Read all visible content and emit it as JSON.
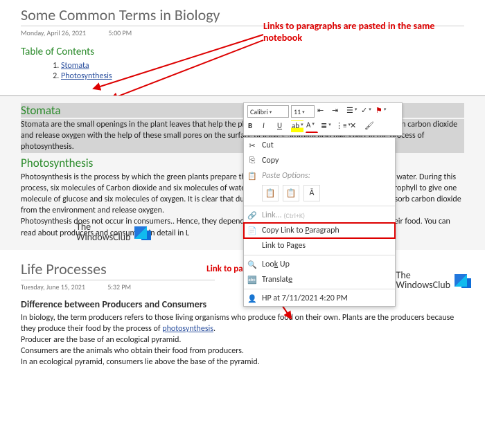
{
  "top": {
    "title": "Some Common Terms in Biology",
    "date": "Monday, April 26, 2021",
    "time": "5:00 PM",
    "tocHeading": "Table of Contents",
    "tocItems": [
      "Stomata",
      "Photosynthesis"
    ],
    "sec1Title": "Stomata",
    "sec1Body": "Stomata are the small openings in the plant leaves that help the plants in the exchange of gases. The plants take in carbon dioxide and release oxygen with the help of these small pores on the surface of leaves. Stomata also takes part in the process of photosynthesis.",
    "sec2Title": "Photosynthesis",
    "sec2Body1": "Photosynthesis is the process by which the green plants prepare their own food in the presence of sunlight and water. During this process, six molecules of Carbon dioxide and six molecules of water combine in the presence of water and chlorophyll to give one molecule of glucose and six molecules of oxygen. It is clear that during the process of photosynthesis, plants absorb carbon dioxide from the environment and release oxygen.",
    "sec2Body2a": "Photosynthesis does not occur in consumers.. Hence, they depend on other organisms (producers) to obtain their food. You can read about producers and consumers in detail in L"
  },
  "annot": {
    "a1": "Links to paragraphs are pasted in the same notebook",
    "a2": "Link to paragraph is pasted in another notebook"
  },
  "toolbar": {
    "font": "Calibri",
    "size": "11"
  },
  "ctx": {
    "cut": "Cut",
    "copy": "Copy",
    "pasteOpts": "Paste Options:",
    "link": "Link...",
    "linkHint": "(Ctrl+K)",
    "copyLinkPara": "Copy Link to Paragraph",
    "linkPages": "Link to Pages",
    "lookUp": "Look Up",
    "translate": "Translate",
    "hp": "HP at 7/11/2021 4:20 PM"
  },
  "logo": {
    "l1": "The",
    "l2": "WindowsClub"
  },
  "bottom": {
    "title": "Life Processes",
    "date": "Tuesday, June 15, 2021",
    "time": "5:32 PM",
    "heading": "Difference between Producers and Consumers",
    "p1a": "In biology, the term producers refers to those living organisms who produce food on their own. Plants are the producers because they produce their food by the process of ",
    "p1link": "photosynthesis",
    "p1b": ".",
    "p2": "Producer are the base of an ecological pyramid.",
    "p3": "Consumers are the animals who obtain their food from producers.",
    "p4": "In an ecological pyramid, consumers lie above the base of the pyramid."
  }
}
